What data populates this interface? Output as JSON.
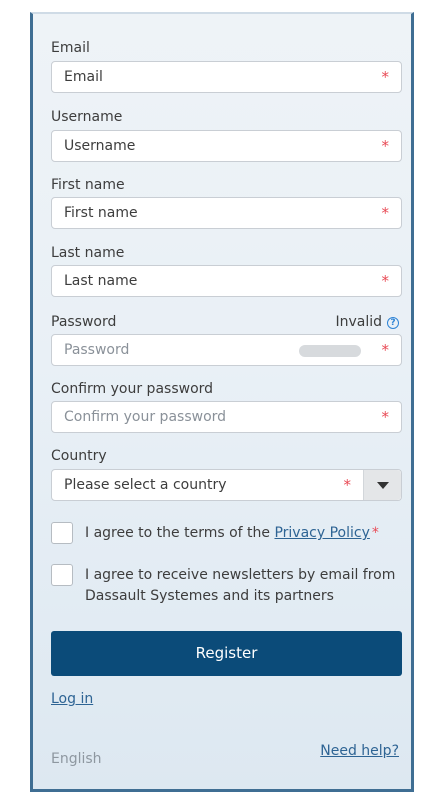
{
  "form": {
    "email": {
      "label": "Email",
      "placeholder": "Email"
    },
    "username": {
      "label": "Username",
      "placeholder": "Username"
    },
    "first_name": {
      "label": "First name",
      "placeholder": "First name"
    },
    "last_name": {
      "label": "Last name",
      "placeholder": "Last name"
    },
    "password": {
      "label": "Password",
      "placeholder": "Password",
      "status": "Invalid"
    },
    "confirm_password": {
      "label": "Confirm your password",
      "placeholder": "Confirm your password"
    },
    "country": {
      "label": "Country",
      "selected": "Please select a country"
    },
    "required_mark": "*"
  },
  "agreements": {
    "privacy_prefix": "I agree to the terms of the ",
    "privacy_link": "Privacy Policy",
    "newsletter": "I agree to receive newsletters by email from Dassault Systemes and its partners"
  },
  "actions": {
    "register": "Register",
    "login": "Log in",
    "help": "Need help?"
  },
  "footer": {
    "language": "English"
  },
  "colors": {
    "primary": "#0b4b79",
    "required": "#e84a55",
    "link": "#2e6494",
    "info": "#2f84d6"
  }
}
